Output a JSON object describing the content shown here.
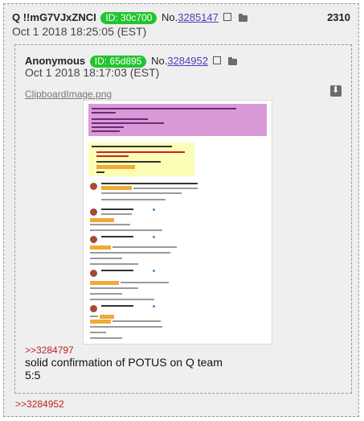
{
  "outer": {
    "name": "Q !!mG7VJxZNCI",
    "id_label": "ID: 30c700",
    "no_label": "No.",
    "no_value": "3285147",
    "post_number": "2310",
    "date": "Oct 1 2018 18:25:05 (EST)"
  },
  "inner": {
    "name": "Anonymous",
    "id_label": "ID: 65d895",
    "no_label": "No.",
    "no_value": "3284952",
    "date": "Oct 1 2018 18:17:03 (EST)",
    "file_name": "ClipboardImage.png",
    "reply_link": ">>3284797",
    "message_line1": "solid confirmation of POTUS on Q team",
    "message_line2": "5:5"
  },
  "footer": {
    "reply_link": ">>3284952"
  },
  "icons": [
    "external-link-icon",
    "folder-icon",
    "download-icon"
  ],
  "colors": {
    "id_badge": "#22c42e",
    "link": "#4f3cb8",
    "reply": "#c22222"
  }
}
